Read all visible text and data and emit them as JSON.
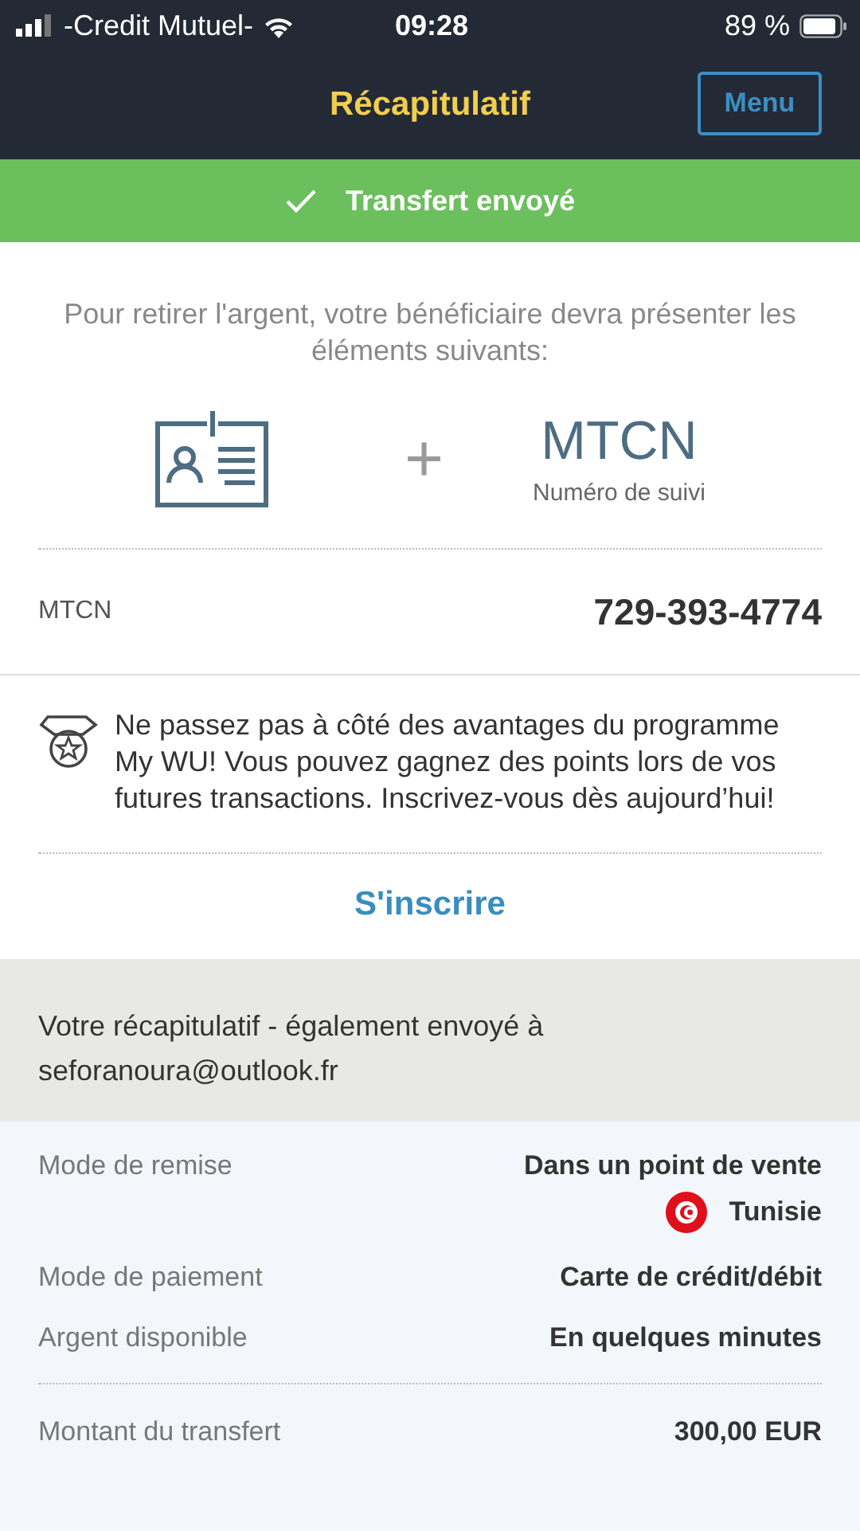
{
  "status_bar": {
    "carrier": "-Credit Mutuel-",
    "time": "09:28",
    "battery": "89 %"
  },
  "header": {
    "title": "Récapitulatif",
    "menu_button": "Menu"
  },
  "banner": {
    "text": "Transfert envoyé"
  },
  "instructions": "Pour retirer l'argent, votre bénéficiaire devra présenter les éléments suivants:",
  "requirements": {
    "plus": "+",
    "code": "MTCN",
    "code_caption": "Numéro de suivi"
  },
  "mtcn": {
    "label": "MTCN",
    "value": "729-393-4774"
  },
  "promo": {
    "text": "Ne passez pas à côté des avantages du programme My WU! Vous pouvez gagnez des points lors de vos futures transactions. Inscrivez-vous dès aujourd’hui!",
    "link": "S'inscrire"
  },
  "summary": {
    "text": "Votre récapitulatif - également envoyé à",
    "email": "seforanoura@outlook.fr"
  },
  "details": {
    "rows": [
      {
        "label": "Mode de remise",
        "value": "Dans un point de vente",
        "country": "Tunisie"
      },
      {
        "label": "Mode de paiement",
        "value": "Carte de crédit/débit"
      },
      {
        "label": "Argent disponible",
        "value": "En quelques minutes"
      }
    ],
    "total": {
      "label": "Montant du transfert",
      "value": "300,00 EUR"
    }
  }
}
